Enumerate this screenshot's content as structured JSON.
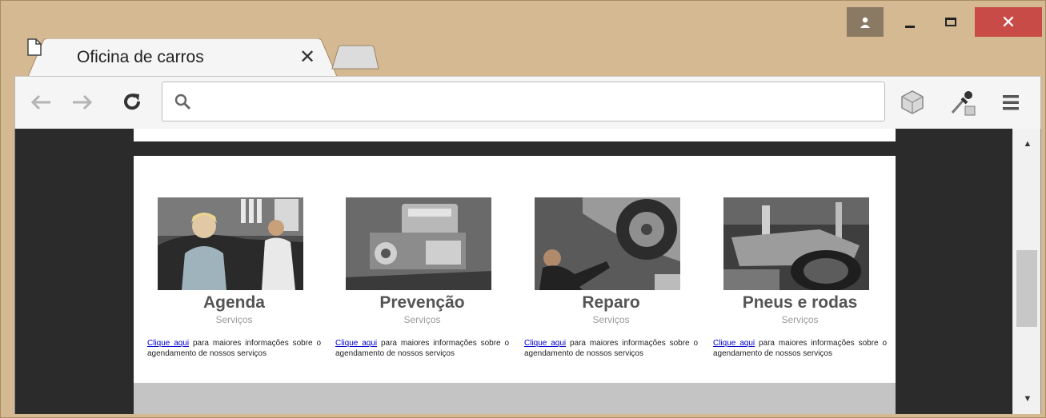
{
  "browser": {
    "tab_title": "Oficina de carros",
    "omnibox_value": "",
    "omnibox_placeholder": ""
  },
  "services": [
    {
      "title": "Agenda",
      "subtitle": "Serviços",
      "link_text": "Clique aqui",
      "desc_line1": "para maiores",
      "desc_rest": "informações sobre o agendamento de nossos serviços"
    },
    {
      "title": "Prevenção",
      "subtitle": "Serviços",
      "link_text": "Clique aqui",
      "desc_line1": "para maiores",
      "desc_rest": "informações sobre o agendamento de nossos serviços"
    },
    {
      "title": "Reparo",
      "subtitle": "Serviços",
      "link_text": "Clique aqui",
      "desc_line1": "para maiores",
      "desc_rest": "informações sobre o agendamento de nossos serviços"
    },
    {
      "title": "Pneus e rodas",
      "subtitle": "Serviços",
      "link_text": "Clique aqui",
      "desc_line1": "para maiores",
      "desc_rest": "informações sobre o agendamento de nossos serviços"
    }
  ],
  "colors": {
    "window_frame": "#d4b993",
    "close_button": "#c94b47",
    "page_background": "#2b2b2b",
    "link": "#0000cc"
  }
}
